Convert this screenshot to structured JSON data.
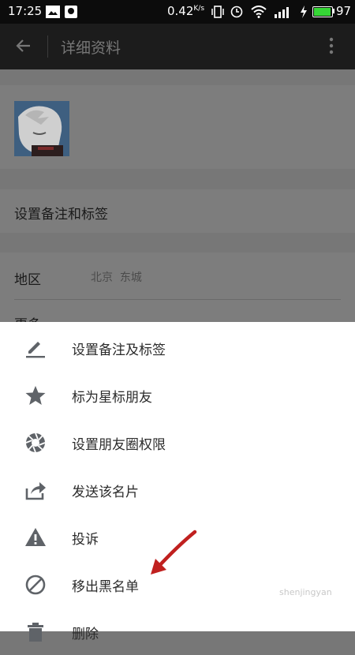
{
  "status_bar": {
    "time": "17:25",
    "speed": "0.42",
    "speed_unit": "K/s",
    "battery": "97",
    "battery_level": 0.97,
    "battery_color": "#36d636"
  },
  "app_bar": {
    "title": "详细资料",
    "back_icon": "arrow-left-icon",
    "more_icon": "more-vert-icon"
  },
  "profile": {
    "remark_row_label": "设置备注和标签",
    "region_label": "地区",
    "region_value": "北京  东城",
    "more_label": "更多"
  },
  "sheet": {
    "items": [
      {
        "label": "设置备注及标签",
        "icon": "edit-pencil-icon"
      },
      {
        "label": "标为星标朋友",
        "icon": "star-icon"
      },
      {
        "label": "设置朋友圈权限",
        "icon": "aperture-icon"
      },
      {
        "label": "发送该名片",
        "icon": "share-icon"
      },
      {
        "label": "投诉",
        "icon": "warning-icon"
      },
      {
        "label": "移出黑名单",
        "icon": "block-icon"
      },
      {
        "label": "删除",
        "icon": "trash-icon"
      }
    ]
  },
  "annotation": {
    "arrow_color": "#c0201f"
  },
  "watermark": "shenjingyan"
}
